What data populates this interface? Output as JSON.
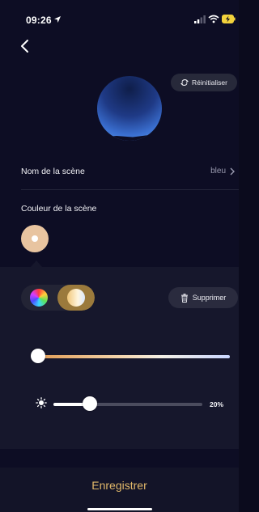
{
  "status_bar": {
    "time": "09:26",
    "icons": [
      "location-arrow-icon",
      "signal-icon",
      "wifi-icon",
      "battery-charging-icon"
    ]
  },
  "header": {
    "back_icon": "chevron-left-icon",
    "reset_label": "Réinitialiser",
    "reset_icon": "reset-icon"
  },
  "scene": {
    "name_label": "Nom de la scène",
    "name_value": "bleu",
    "color_label": "Couleur de la scène",
    "swatch_color": "#e8c4a0"
  },
  "panel": {
    "modes": [
      {
        "id": "rgb",
        "icon": "color-wheel-icon",
        "selected": false
      },
      {
        "id": "white",
        "icon": "white-temperature-icon",
        "selected": true
      }
    ],
    "delete_label": "Supprimer",
    "delete_icon": "trash-icon",
    "temperature_level": 0,
    "brightness_icon": "sun-icon",
    "brightness_percent": 20,
    "brightness_label": "20%"
  },
  "footer": {
    "save_label": "Enregistrer",
    "accent_color": "#e2b96a"
  }
}
